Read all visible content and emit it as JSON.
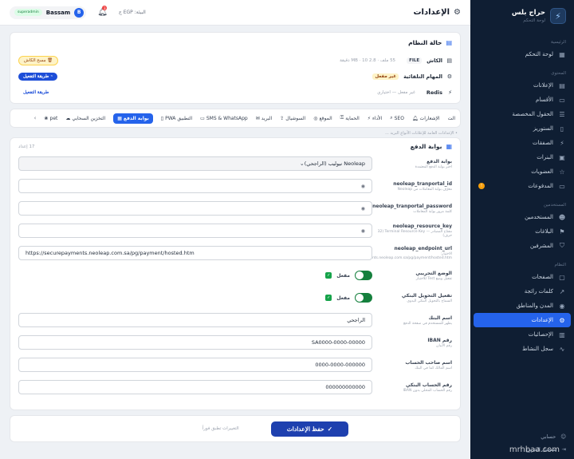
{
  "sidebar": {
    "brand_name": "حراج بلس",
    "brand_sub": "لوحة التحكم",
    "sections": [
      {
        "title": "الرئيسية",
        "items": [
          {
            "label": "لوحة التحكم",
            "icon": "grid-icon",
            "glyph": "▦"
          }
        ]
      },
      {
        "title": "المحتوى",
        "items": [
          {
            "label": "الإعلانات",
            "icon": "megaphone-icon",
            "glyph": "▤"
          },
          {
            "label": "الأقسام",
            "icon": "folder-icon",
            "glyph": "▭"
          },
          {
            "label": "الحقول المخصصة",
            "icon": "fields-icon",
            "glyph": "☰"
          },
          {
            "label": "الستوريز",
            "icon": "book-icon",
            "glyph": "▯"
          },
          {
            "label": "الصفقات",
            "icon": "deal-icon",
            "glyph": "⚡"
          },
          {
            "label": "البنرات",
            "icon": "image-icon",
            "glyph": "▣"
          },
          {
            "label": "العضويات",
            "icon": "star-icon",
            "glyph": "☆"
          },
          {
            "label": "المدفوعات",
            "icon": "card-icon",
            "glyph": "▭",
            "badge": "!"
          }
        ]
      },
      {
        "title": "المستخدمين",
        "items": [
          {
            "label": "المستخدمين",
            "icon": "users-icon",
            "glyph": "☻"
          },
          {
            "label": "البلاغات",
            "icon": "flag-icon",
            "glyph": "⚑"
          },
          {
            "label": "المشرفين",
            "icon": "shield-icon",
            "glyph": "⛉"
          }
        ]
      },
      {
        "title": "النظام",
        "items": [
          {
            "label": "الصفحات",
            "icon": "page-icon",
            "glyph": "▢"
          },
          {
            "label": "كلمات رائجة",
            "icon": "chart-icon",
            "glyph": "↗"
          },
          {
            "label": "المدن والمناطق",
            "icon": "pin-icon",
            "glyph": "◉"
          },
          {
            "label": "الإعدادات",
            "icon": "gear-icon",
            "glyph": "⚙",
            "active": true
          },
          {
            "label": "الإحصائيات",
            "icon": "stats-icon",
            "glyph": "▥"
          },
          {
            "label": "سجل النشاط",
            "icon": "activity-icon",
            "glyph": "∿"
          }
        ]
      }
    ],
    "bottom": [
      {
        "label": "حسابي",
        "icon": "user-icon",
        "glyph": "☺"
      },
      {
        "label": "تسجيل الخروج",
        "icon": "logout-icon",
        "glyph": "⇥"
      }
    ]
  },
  "topbar": {
    "title": "الإعدادات",
    "env_text": "البيئة: EGP ج",
    "notif_count": "3",
    "user_initial": "B",
    "user_name": "Bassam",
    "role": "superadmin"
  },
  "system": {
    "title": "حالة النظام",
    "cache": {
      "label": "الكاش",
      "tag": "FILE",
      "meta": "55 ملف · 2.8 MB · 10 دقيقة",
      "button": "مسح الكاش"
    },
    "queue": {
      "label": "المهام التلقائية",
      "tag": "غير مفعل",
      "button": "طريقة التفعيل"
    },
    "redis": {
      "label": "Redis",
      "meta": "غير مفعل — اختياري",
      "button": "طريقة التفعيل"
    }
  },
  "tabs": {
    "items": [
      {
        "label": "الإشعارات",
        "icon": "bell-icon"
      },
      {
        "label": "SEO",
        "icon": "search-icon"
      },
      {
        "label": "الأداء",
        "icon": "bolt-icon"
      },
      {
        "label": "الحماية",
        "icon": "lock-icon"
      },
      {
        "label": "الموقع",
        "icon": "globe-icon"
      },
      {
        "label": "السوشيال",
        "icon": "share-icon"
      },
      {
        "label": "البريد",
        "icon": "mail-icon"
      },
      {
        "label": "SMS & WhatsApp",
        "icon": "chat-icon"
      },
      {
        "label": "التطبيق PWA",
        "icon": "phone-icon"
      },
      {
        "label": "بوابة الدفع",
        "icon": "card-icon",
        "active": true
      },
      {
        "label": "التخزين السحابي",
        "icon": "cloud-icon"
      },
      {
        "label": "pet",
        "icon": "paw-icon"
      }
    ],
    "prev": "‹",
    "next": "›",
    "trailing": "الت"
  },
  "breadcrumb": "• الإعدادات العامة للإعلانات الأنواع البريد ...",
  "gateway": {
    "title": "بوابة الدفع",
    "count": "17 إعداد",
    "fields": [
      {
        "label": "بوابة الدفع",
        "desc": "اختر بوابة الدفع المعتمدة",
        "value": "Neoleap نيوليب (الراجحي)",
        "kind": "select"
      },
      {
        "label": "neoleap_tranportal_id",
        "desc": "معرّف بوابة المعاملات من Neoleap",
        "value": "",
        "kind": "secret"
      },
      {
        "label": "neoleap_tranportal_password",
        "desc": "كلمة مرور بوابة المعاملات",
        "value": "",
        "kind": "secret"
      },
      {
        "label": "neoleap_resource_key",
        "desc": "مفتاح المصادر — Terminal Resource Key (32 حرف)",
        "value": "",
        "kind": "secret"
      },
      {
        "label": "neoleap_endpoint_url",
        "desc": "الاختبار: https://securepayments.neoleap.com.sa/pg/payment/hosted.htm",
        "value": "https://securepayments.neoleap.com.sa/pg/payment/hosted.htm",
        "kind": "text-ltr"
      },
      {
        "label": "الوضع التجريبي",
        "desc": "تفعيل وضع Test للاختبار",
        "value": "مفعل",
        "kind": "toggle"
      },
      {
        "label": "تفعيل التحويل البنكي",
        "desc": "السماح بالتحويل البنكي اليدوي",
        "value": "مفعل",
        "kind": "toggle"
      },
      {
        "label": "اسم البنك",
        "desc": "يظهر للمستخدم في صفحة الدفع",
        "value": "الراجحي",
        "kind": "text"
      },
      {
        "label": "رقم IBAN",
        "desc": "رقم الآيبان",
        "value": "SA0000-0000-00000",
        "kind": "text"
      },
      {
        "label": "اسم صاحب الحساب",
        "desc": "اسم المالك كما في البنك",
        "value": "0000-0000-000000",
        "kind": "text"
      },
      {
        "label": "رقم الحساب البنكي",
        "desc": "رقم الحساب المحلي بدون IBAN",
        "value": "000000000000",
        "kind": "text"
      }
    ]
  },
  "save": {
    "label": "حفظ الإعدادات",
    "hint": "التغييرات تطبق فوراً"
  },
  "watermark": "mrhbaa.com"
}
